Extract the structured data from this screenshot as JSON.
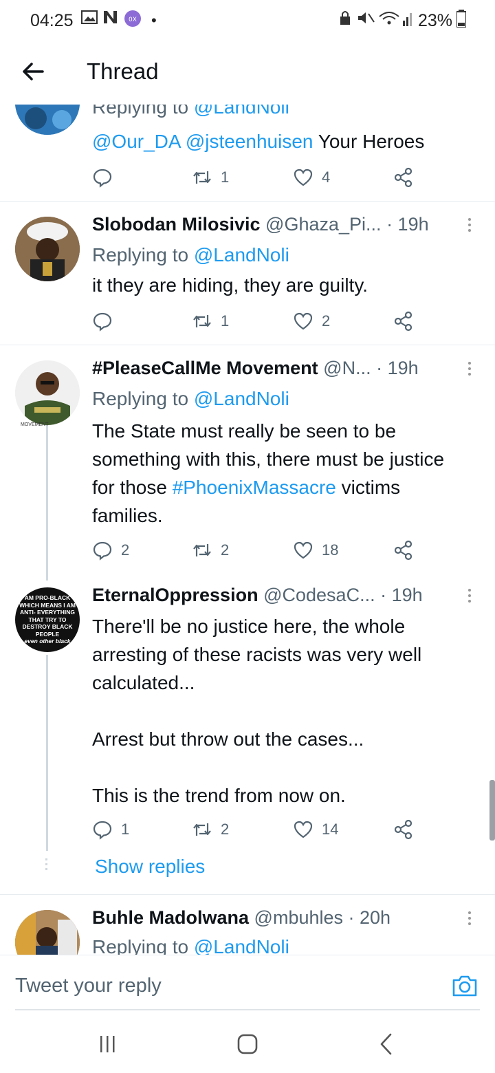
{
  "status_bar": {
    "time": "04:25",
    "battery": "23%"
  },
  "header": {
    "title": "Thread"
  },
  "tweets": [
    {
      "reply_to_prefix": "Replying to ",
      "reply_to_handle": "@LandNoli",
      "mention1": "@Our_DA",
      "mention2": "@jsteenhuisen",
      "text_after": " Your Heroes",
      "replies": "",
      "retweets": "1",
      "likes": "4"
    },
    {
      "name": "Slobodan Milosivic",
      "handle": "@Ghaza_Pi...",
      "time": "· 19h",
      "reply_to_prefix": "Replying to ",
      "reply_to_handle": "@LandNoli",
      "text": "it they are hiding, they are guilty.",
      "replies": "",
      "retweets": "1",
      "likes": "2"
    },
    {
      "name": "#PleaseCallMe Movement",
      "handle": "@N...",
      "time": "· 19h",
      "reply_to_prefix": "Replying to ",
      "reply_to_handle": "@LandNoli",
      "text_before": "The State must really be seen to be something with this, there must be justice for those ",
      "hashtag": "#PhoenixMassacre",
      "text_after": " victims families.",
      "replies": "2",
      "retweets": "2",
      "likes": "18",
      "avatar_caption": "MOVEMENT"
    },
    {
      "name": "EternalOppression",
      "handle": "@CodesaC...",
      "time": "· 19h",
      "text": "There'll be no justice here, the whole arresting of these racists was very well calculated...\n\nArrest but throw out the cases...\n\nThis is the trend from now on.",
      "replies": "1",
      "retweets": "2",
      "likes": "14",
      "show_replies": "Show replies",
      "avatar_text": [
        "AM PRO-BLACK",
        "WHICH MEANS I AM",
        "ANTI- EVERYTHING",
        "THAT TRY TO",
        "DESTROY BLACK",
        "PEOPLE",
        "even other black"
      ]
    },
    {
      "name": "Buhle Madolwana",
      "handle": "@mbuhles",
      "time": "· 20h",
      "reply_to_prefix": "Replying to ",
      "reply_to_handle": "@LandNoli"
    }
  ],
  "composer": {
    "placeholder": "Tweet your reply"
  },
  "icons": {
    "back": "arrow-left-icon",
    "reply": "comment-bubble-icon",
    "retweet": "retweet-icon",
    "like": "heart-icon",
    "share": "share-icon",
    "camera": "camera-icon"
  },
  "colors": {
    "link": "#1d9bf0",
    "muted": "#536471",
    "text": "#0f1419"
  }
}
